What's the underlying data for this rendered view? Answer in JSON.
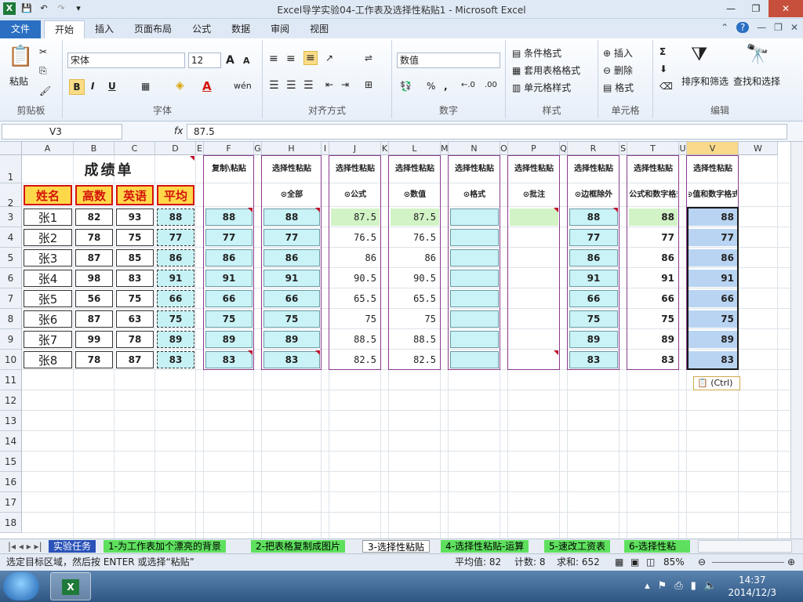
{
  "window": {
    "title": "Excel导学实验04-工作表及选择性粘贴1 - Microsoft Excel",
    "controls": [
      "—",
      "❐",
      "✕"
    ]
  },
  "qat": {
    "app_icon": "X",
    "save_icon": "save-icon",
    "undo": "↶",
    "redo": "↷",
    "customize": "▾"
  },
  "ribbon_tabs": [
    "文件",
    "开始",
    "插入",
    "页面布局",
    "公式",
    "数据",
    "审阅",
    "视图"
  ],
  "ribbon_right": [
    "⌃",
    "?",
    "—",
    "❐",
    "✕"
  ],
  "ribbon": {
    "clipboard": {
      "paste": "粘贴",
      "label": "剪贴板"
    },
    "font": {
      "name": "宋体",
      "size": "12",
      "bold": "B",
      "italic": "I",
      "underline": "U",
      "label": "字体",
      "grow": "A",
      "shrink": "A",
      "wen": "wén"
    },
    "alignment": {
      "label": "对齐方式"
    },
    "number": {
      "format": "数值",
      "percent": "%",
      "comma": ",",
      "label": "数字",
      "inc": "←.0",
      "dec": ".00"
    },
    "styles": {
      "conditional": "条件格式",
      "table": "套用表格格式",
      "cell": "单元格样式",
      "label": "样式"
    },
    "cells": {
      "insert": "插入",
      "delete": "删除",
      "format": "格式",
      "label": "单元格"
    },
    "editing": {
      "sort": "排序和筛选",
      "find": "查找和选择",
      "sigma": "Σ",
      "label": "编辑"
    }
  },
  "formula_bar": {
    "name_box": "V3",
    "fx": "fx",
    "value": "87.5"
  },
  "columns": [
    "A",
    "B",
    "C",
    "D",
    "E",
    "F",
    "G",
    "H",
    "I",
    "J",
    "K",
    "L",
    "M",
    "N",
    "O",
    "P",
    "Q",
    "R",
    "S",
    "T",
    "U",
    "V",
    "W"
  ],
  "rows": [
    "1",
    "2",
    "3",
    "4",
    "5",
    "6",
    "7",
    "8",
    "9",
    "10",
    "11",
    "12",
    "13",
    "14",
    "15",
    "16",
    "17",
    "18"
  ],
  "sheet": {
    "title": "成绩单",
    "headers": [
      "姓名",
      "高数",
      "英语",
      "平均"
    ],
    "students": [
      {
        "name": "张1",
        "math": "82",
        "eng": "93",
        "avg": "88"
      },
      {
        "name": "张2",
        "math": "78",
        "eng": "75",
        "avg": "77"
      },
      {
        "name": "张3",
        "math": "87",
        "eng": "85",
        "avg": "86"
      },
      {
        "name": "张4",
        "math": "98",
        "eng": "83",
        "avg": "91"
      },
      {
        "name": "张5",
        "math": "56",
        "eng": "75",
        "avg": "66"
      },
      {
        "name": "张6",
        "math": "87",
        "eng": "63",
        "avg": "75"
      },
      {
        "name": "张7",
        "math": "99",
        "eng": "78",
        "avg": "89"
      },
      {
        "name": "张8",
        "math": "78",
        "eng": "87",
        "avg": "83"
      }
    ],
    "paste_headers": {
      "F": "复制\\粘贴",
      "H": "选择性粘贴",
      "J": "选择性粘贴",
      "L": "选择性粘贴",
      "N": "选择性粘贴",
      "P": "选择性粘贴",
      "R": "选择性粘贴",
      "T": "选择性粘贴",
      "V": "选择性粘贴"
    },
    "paste_options": {
      "H": "⊙全部",
      "J": "⊙公式",
      "L": "⊙数值",
      "N": "⊙格式",
      "P": "⊙批注",
      "R": "⊙边框除外",
      "T": "⊙公式和数字格式",
      "V": "⊙值和数字格式"
    },
    "F": [
      "88",
      "77",
      "86",
      "91",
      "66",
      "75",
      "89",
      "83"
    ],
    "H": [
      "88",
      "77",
      "86",
      "91",
      "66",
      "75",
      "89",
      "83"
    ],
    "J": [
      "87.5",
      "76.5",
      "86",
      "90.5",
      "65.5",
      "75",
      "88.5",
      "82.5"
    ],
    "L": [
      "87.5",
      "76.5",
      "86",
      "90.5",
      "65.5",
      "75",
      "88.5",
      "82.5"
    ],
    "R": [
      "88",
      "77",
      "86",
      "91",
      "66",
      "75",
      "89",
      "83"
    ],
    "T": [
      "88",
      "77",
      "86",
      "91",
      "66",
      "75",
      "89",
      "83"
    ],
    "V": [
      "88",
      "77",
      "86",
      "91",
      "66",
      "75",
      "89",
      "83"
    ]
  },
  "paste_popup": "(Ctrl)",
  "sheet_tabs": [
    "实验任务",
    "1-为工作表加个漂亮的背景",
    "2-把表格复制成图片",
    "3-选择性粘贴",
    "4-选择性粘贴-运算",
    "5-速改工资表",
    "6-选择性粘"
  ],
  "status": {
    "message": "选定目标区域，然后按 ENTER 或选择“粘贴”",
    "average": "平均值: 82",
    "count": "计数: 8",
    "sum": "求和: 652",
    "zoom": "85%"
  },
  "taskbar": {
    "time": "14:37",
    "date": "2014/12/3"
  }
}
